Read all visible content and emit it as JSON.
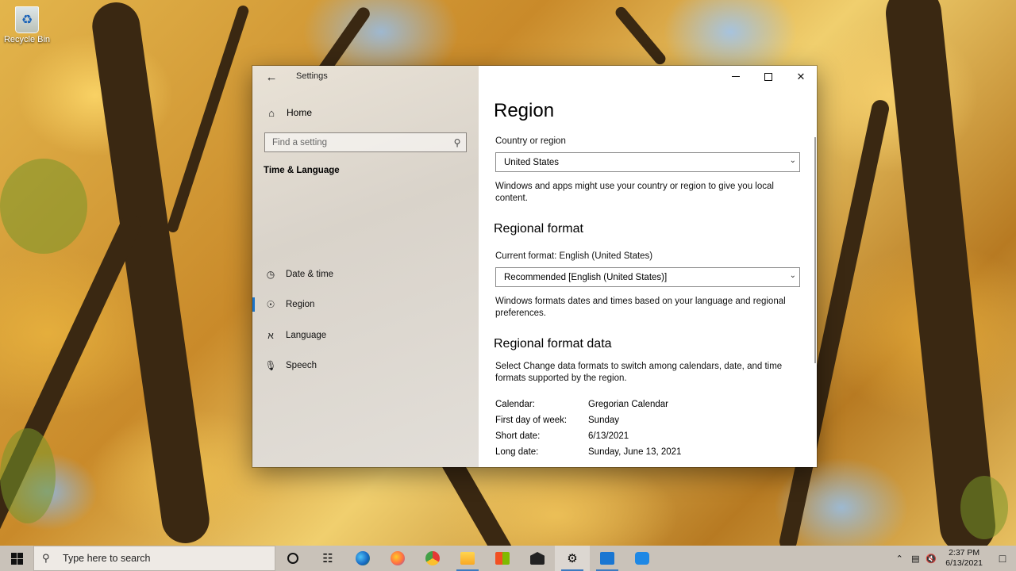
{
  "desktop": {
    "icons": [
      {
        "label": "Recycle Bin",
        "icon": "recycle-bin-icon"
      }
    ]
  },
  "window": {
    "title": "Settings",
    "back_icon": "back-arrow-icon",
    "controls": [
      "minimize",
      "maximize",
      "close"
    ]
  },
  "nav": {
    "home_label": "Home",
    "search_placeholder": "Find a setting",
    "group_title": "Time & Language",
    "items": [
      {
        "label": "Date & time",
        "icon": "calendar-clock-icon",
        "selected": false
      },
      {
        "label": "Region",
        "icon": "globe-icon",
        "selected": true
      },
      {
        "label": "Language",
        "icon": "language-icon",
        "selected": false
      },
      {
        "label": "Speech",
        "icon": "microphone-icon",
        "selected": false
      }
    ]
  },
  "content": {
    "title": "Region",
    "country_label": "Country or region",
    "country_value": "United States",
    "country_note": "Windows and apps might use your country or region to give you local content.",
    "regional_format_title": "Regional format",
    "current_format": "Current format: English (United States)",
    "format_value": "Recommended [English (United States)]",
    "format_note": "Windows formats dates and times based on your language and regional preferences.",
    "format_data_title": "Regional format data",
    "format_data_note": "Select Change data formats to switch among calendars, date, and time formats supported by the region.",
    "format_data": [
      {
        "key": "Calendar:",
        "value": "Gregorian Calendar"
      },
      {
        "key": "First day of week:",
        "value": "Sunday"
      },
      {
        "key": "Short date:",
        "value": "6/13/2021"
      },
      {
        "key": "Long date:",
        "value": "Sunday, June 13, 2021"
      }
    ]
  },
  "taskbar": {
    "search_placeholder": "Type here to search",
    "apps": [
      {
        "name": "cortana-icon"
      },
      {
        "name": "task-view-icon"
      },
      {
        "name": "edge-icon"
      },
      {
        "name": "firefox-icon"
      },
      {
        "name": "chrome-icon"
      },
      {
        "name": "file-explorer-icon"
      },
      {
        "name": "store-icon"
      },
      {
        "name": "mail-icon"
      },
      {
        "name": "settings-icon",
        "active": true
      },
      {
        "name": "outlook-icon"
      },
      {
        "name": "dev-tool-icon"
      }
    ],
    "clock_time": "2:37 PM",
    "clock_date": "6/13/2021"
  },
  "colors": {
    "accent": "#1a73c8",
    "taskbar": "#c9c2b9"
  }
}
